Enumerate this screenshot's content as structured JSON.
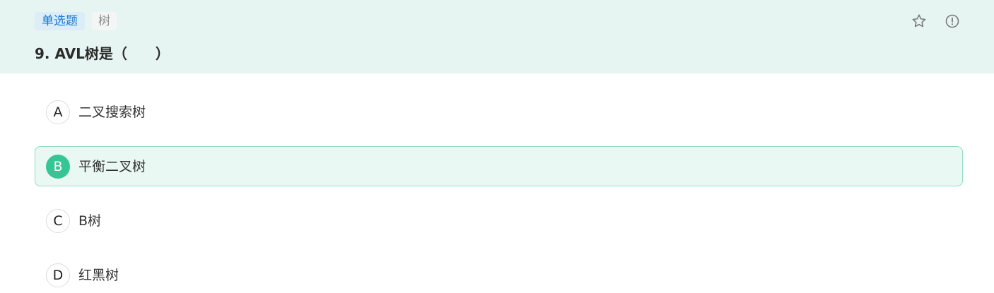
{
  "header": {
    "question_type": "单选题",
    "topic_tag": "树",
    "question": "9. AVL树是（　　）",
    "icons": {
      "favorite": "star-icon",
      "report": "exclamation-circle-icon"
    }
  },
  "options": [
    {
      "letter": "A",
      "text": "二叉搜索树",
      "selected": false
    },
    {
      "letter": "B",
      "text": "平衡二叉树",
      "selected": true
    },
    {
      "letter": "C",
      "text": "B树",
      "selected": false
    },
    {
      "letter": "D",
      "text": "红黑树",
      "selected": false
    }
  ],
  "colors": {
    "header_bg": "#e6f5f1",
    "accent": "#36c595",
    "selected_bg": "#eaf8f4",
    "type_tag_text": "#1a7ad0"
  }
}
